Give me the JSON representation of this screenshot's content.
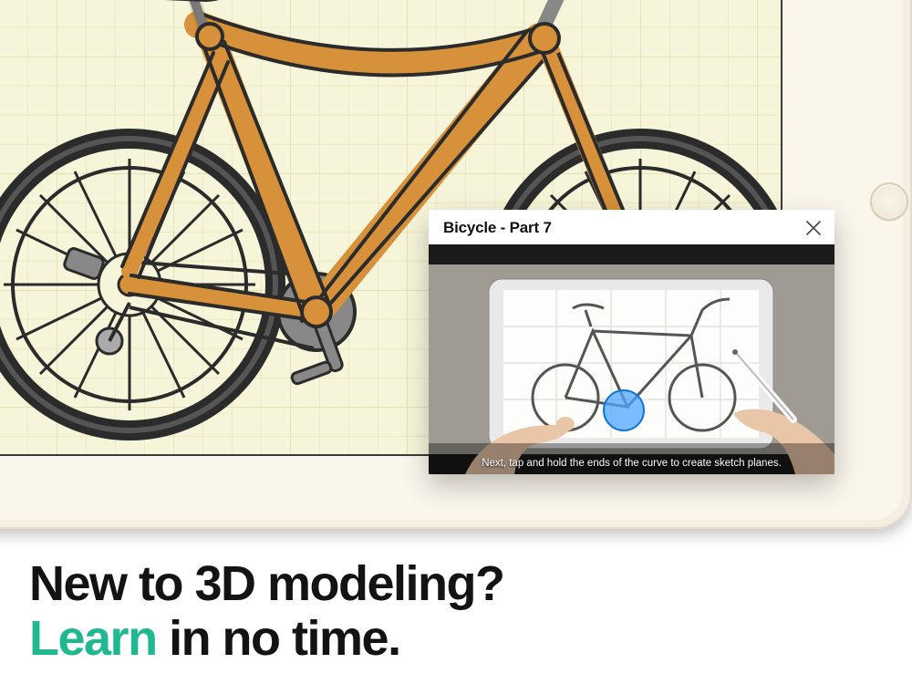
{
  "tutorial": {
    "title": "Bicycle - Part 7",
    "caption": "Next, tap and hold the ends of the curve to create sketch planes."
  },
  "headline": {
    "line1": "New to 3D modeling?",
    "accent": "Learn",
    "line2_rest": " in no time."
  },
  "colors": {
    "accent_green": "#1fb890",
    "bike_frame": "#d6913a",
    "canvas_bg": "#f7f5d9"
  }
}
